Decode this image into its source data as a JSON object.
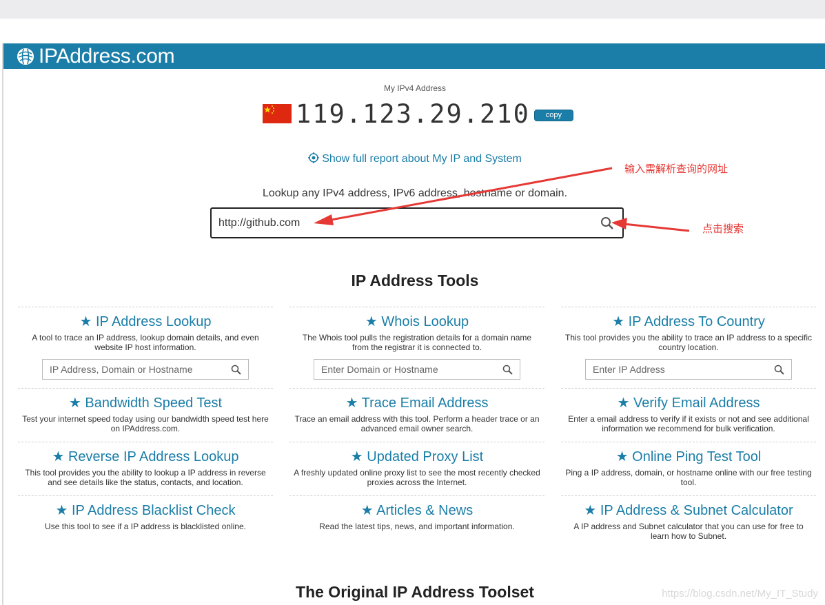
{
  "brand": {
    "name": "IPAddress.com"
  },
  "myip": {
    "label": "My IPv4 Address",
    "ip": "119.123.29.210",
    "copy_label": "copy",
    "report_link": "Show full report about My IP and System"
  },
  "lookup": {
    "label": "Lookup any IPv4 address, IPv6 address, hostname or domain.",
    "value": "http://github.com"
  },
  "annotations": {
    "input_note": "输入需解析查询的网址",
    "search_note": "点击搜索"
  },
  "tools": {
    "title": "IP Address Tools",
    "items": [
      {
        "title": "★ IP Address Lookup",
        "desc": "A tool to trace an IP address, lookup domain details, and even website IP host information.",
        "placeholder": "IP Address, Domain or Hostname"
      },
      {
        "title": "★ Whois Lookup",
        "desc": "The Whois tool pulls the registration details for a domain name from the registrar it is connected to.",
        "placeholder": "Enter Domain or Hostname"
      },
      {
        "title": "★ IP Address To Country",
        "desc": "This tool provides you the ability to trace an IP address to a specific country location.",
        "placeholder": "Enter IP Address"
      },
      {
        "title": "★ Bandwidth Speed Test",
        "desc": "Test your internet speed today using our bandwidth speed test here on IPAddress.com."
      },
      {
        "title": "★ Trace Email Address",
        "desc": "Trace an email address with this tool. Perform a header trace or an advanced email owner search."
      },
      {
        "title": "★ Verify Email Address",
        "desc": "Enter a email address to verify if it exists or not and see additional information we recommend for bulk verification."
      },
      {
        "title": "★ Reverse IP Address Lookup",
        "desc": "This tool provides you the ability to lookup a IP address in reverse and see details like the status, contacts, and location."
      },
      {
        "title": "★ Updated Proxy List",
        "desc": "A freshly updated online proxy list to see the most recently checked proxies across the Internet."
      },
      {
        "title": "★ Online Ping Test Tool",
        "desc": "Ping a IP address, domain, or hostname online with our free testing tool."
      },
      {
        "title": "★ IP Address Blacklist Check",
        "desc": "Use this tool to see if a IP address is blacklisted online."
      },
      {
        "title": "★ Articles & News",
        "desc": "Read the latest tips, news, and important information."
      },
      {
        "title": "★ IP Address & Subnet Calculator",
        "desc": "A IP address and Subnet calculator that you can use for free to learn how to Subnet."
      }
    ]
  },
  "toolset": {
    "title": "The Original IP Address Toolset"
  },
  "watermark": "https://blog.csdn.net/My_IT_Study"
}
